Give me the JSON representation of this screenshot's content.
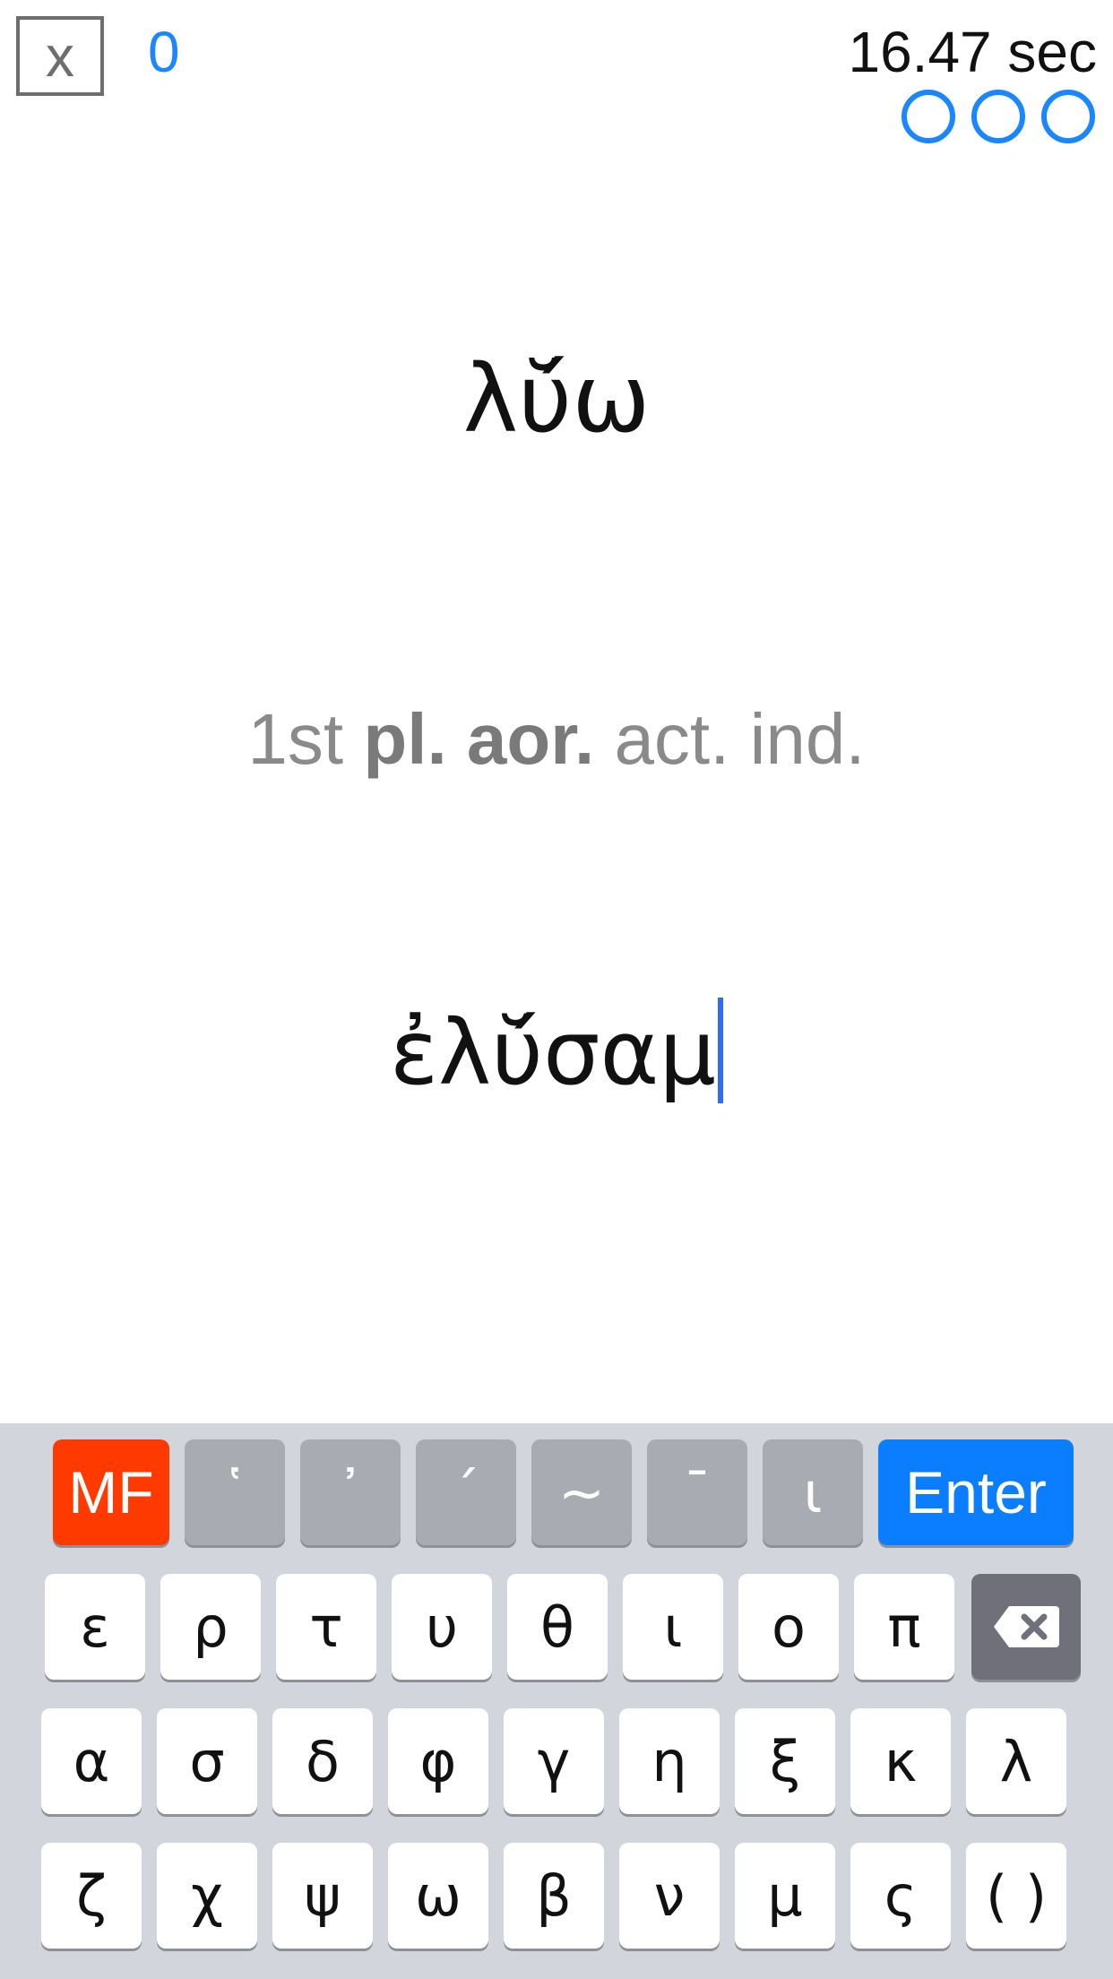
{
  "header": {
    "quit_label": "x",
    "score": "0",
    "timer": "16.47 sec",
    "lives_remaining": 3
  },
  "prompt": {
    "lemma": "λῠ́ω",
    "parsing_person": "1st",
    "parsing_number_tense": "pl. aor.",
    "parsing_voice_mood": "act. ind."
  },
  "answer": {
    "value": "ἐλῠ́σαμ"
  },
  "keyboard": {
    "mf_label": "MF",
    "enter_label": "Enter",
    "diacritics": [
      "῾",
      "᾿",
      "´",
      "~",
      "¯",
      "ι"
    ],
    "row1": [
      "ε",
      "ρ",
      "τ",
      "υ",
      "θ",
      "ι",
      "ο",
      "π"
    ],
    "row2": [
      "α",
      "σ",
      "δ",
      "φ",
      "γ",
      "η",
      "ξ",
      "κ",
      "λ"
    ],
    "row3": [
      "ζ",
      "χ",
      "ψ",
      "ω",
      "β",
      "ν",
      "μ",
      "ς",
      "( )"
    ]
  },
  "colors": {
    "accent": "#1a86ff",
    "mf": "#ff3a00",
    "enter": "#0a7eff",
    "caret": "#2f6bff",
    "keyboard_bg": "#d2d5db",
    "diacritic_key": "#a9abb3",
    "backspace_key": "#6f707a"
  }
}
